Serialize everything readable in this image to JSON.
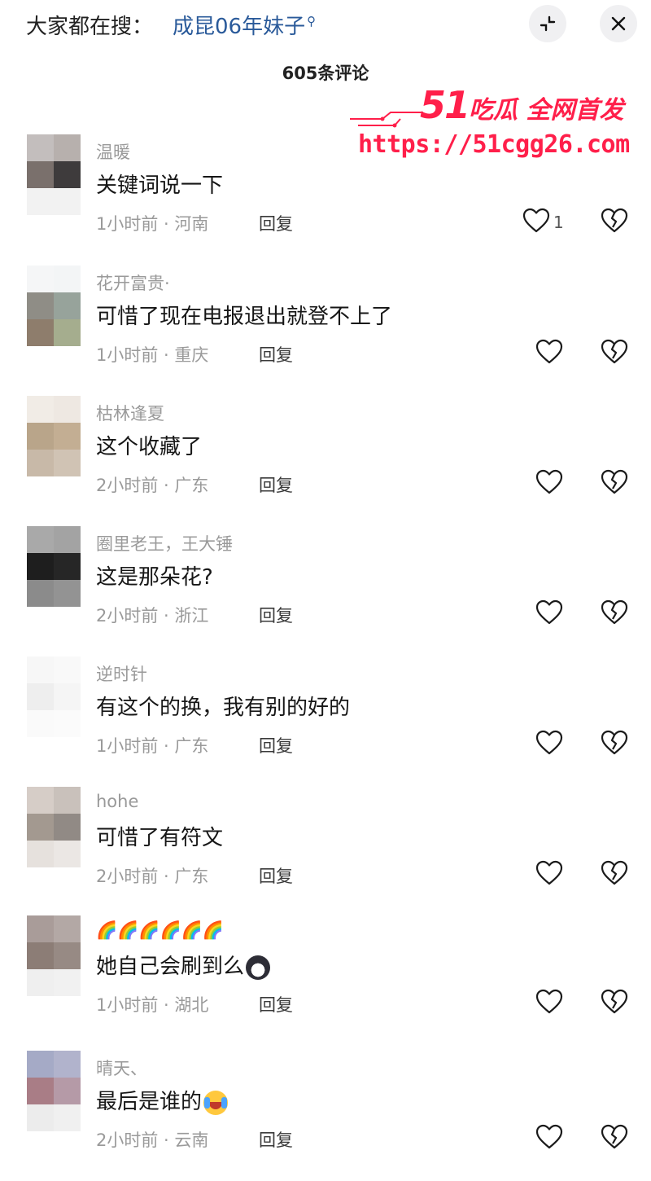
{
  "header": {
    "search_prefix": "大家都在搜：",
    "search_term": "成昆06年妹子",
    "search_suffix_icon": "search-icon",
    "collapse_icon": "collapse-icon",
    "close_icon": "close-icon"
  },
  "comments_header": {
    "count_label": "605条评论"
  },
  "watermark": {
    "brand_number": "51",
    "brand_text": "吃瓜 全网首发",
    "url": "https://51cgg26.com"
  },
  "reply_label": "回复",
  "comments": [
    {
      "user": "温暖",
      "text": "关键词说一下",
      "time": "1小时前",
      "loc": "河南",
      "likes": "1",
      "avatar": [
        "#c3bebd",
        "#b7b0ad",
        "#7a706c",
        "#3e3b3c",
        "#f2f2f2",
        "#f2f2f2"
      ]
    },
    {
      "user": "花开富贵·",
      "text": "可惜了现在电报退出就登不上了",
      "time": "1小时前",
      "loc": "重庆",
      "likes": "",
      "avatar": [
        "#f5f6f7",
        "#f3f5f6",
        "#8f8d86",
        "#97a39b",
        "#8e7d6c",
        "#a5ad8e"
      ]
    },
    {
      "user": "枯林逢夏",
      "text": "这个收藏了",
      "time": "2小时前",
      "loc": "广东",
      "likes": "",
      "avatar": [
        "#f1ece6",
        "#eee8e2",
        "#b9a58a",
        "#c3ae93",
        "#c8b9a8",
        "#d0c3b4"
      ]
    },
    {
      "user": "圈里老王，王大锤",
      "text": "这是那朵花?",
      "time": "2小时前",
      "loc": "浙江",
      "likes": "",
      "avatar": [
        "#a9a9a9",
        "#a3a3a3",
        "#1e1e1e",
        "#262626",
        "#8b8b8b",
        "#939393"
      ]
    },
    {
      "user": "逆时针",
      "text": "有这个的换，我有别的好的",
      "time": "1小时前",
      "loc": "广东",
      "likes": "",
      "avatar": [
        "#f7f7f7",
        "#f9f9f9",
        "#eeeeee",
        "#f5f5f5",
        "#fafafa",
        "#fbfbfb"
      ]
    },
    {
      "user": "hohe",
      "text": "可惜了有符文",
      "time": "2小时前",
      "loc": "广东",
      "likes": "",
      "avatar": [
        "#d6cdc7",
        "#c9c1bb",
        "#a39990",
        "#918a85",
        "#e6e1dd",
        "#ebe7e4"
      ]
    },
    {
      "user": "🌈🌈🌈🌈🌈🌈",
      "text": "她自己会刷到么",
      "time": "1小时前",
      "loc": "湖北",
      "likes": "",
      "avatar": [
        "#a99c99",
        "#b3a8a5",
        "#8c7d76",
        "#978a84",
        "#efefef",
        "#f1f1f1"
      ]
    },
    {
      "user": "晴天、",
      "text": "最后是谁的",
      "time": "2小时前",
      "loc": "云南",
      "likes": "",
      "avatar": [
        "#a5aac6",
        "#b1b3cc",
        "#a97d86",
        "#b59aa7",
        "#ececec",
        "#f0f0f0"
      ]
    }
  ]
}
